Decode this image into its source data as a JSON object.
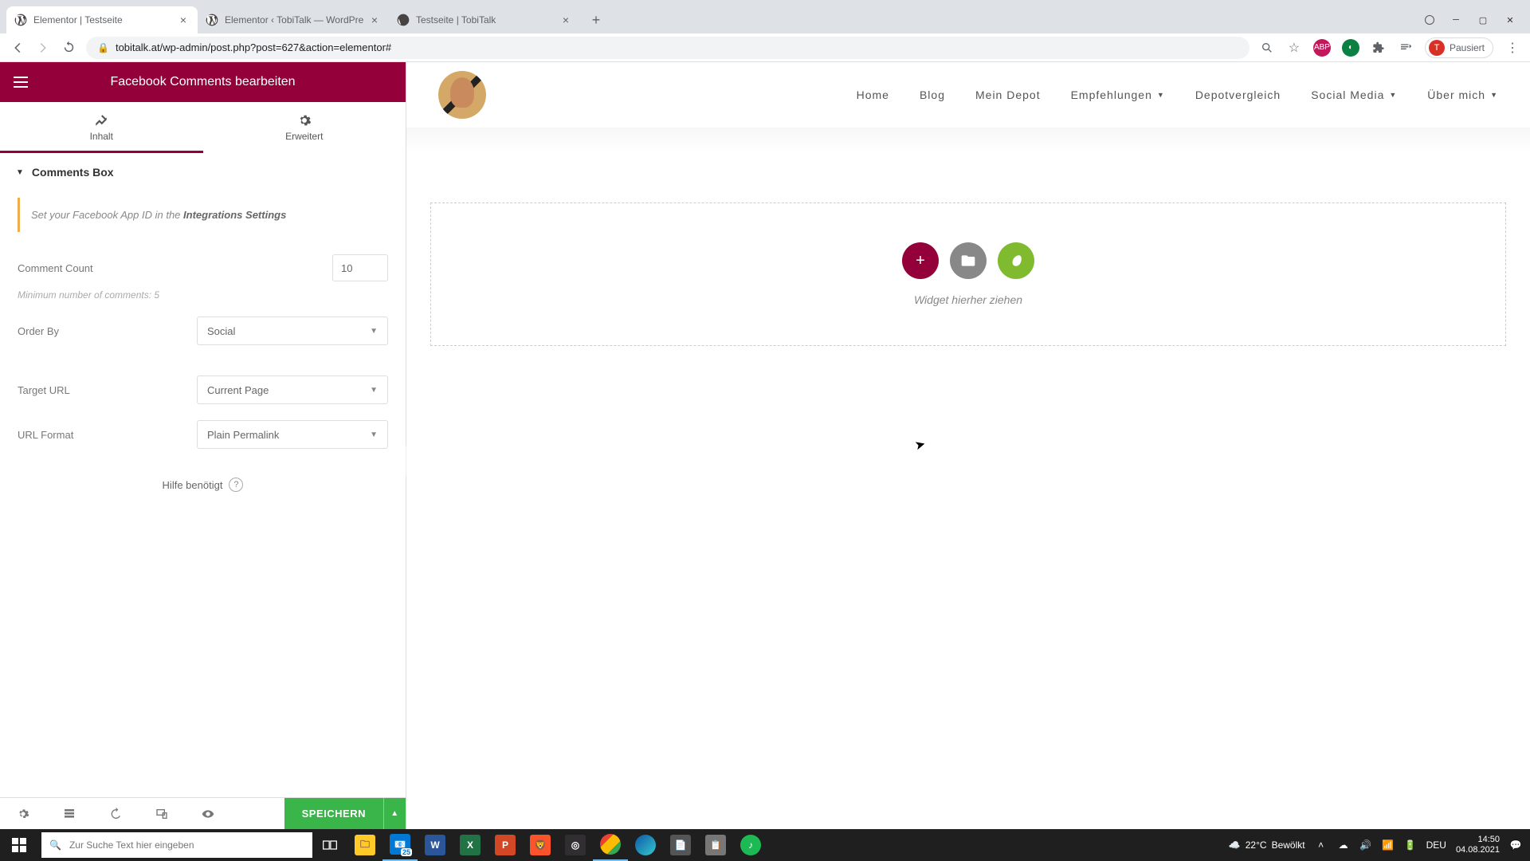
{
  "browser": {
    "tabs": [
      {
        "title": "Elementor | Testseite",
        "active": true
      },
      {
        "title": "Elementor ‹ TobiTalk — WordPre",
        "active": false
      },
      {
        "title": "Testseite | TobiTalk",
        "active": false
      }
    ],
    "url": "tobitalk.at/wp-admin/post.php?post=627&action=elementor#",
    "pause_label": "Pausiert",
    "avatar_letter": "T"
  },
  "sidebar": {
    "title": "Facebook Comments bearbeiten",
    "tabs": {
      "content": "Inhalt",
      "advanced": "Erweitert"
    },
    "section": "Comments Box",
    "notice_pre": "Set your Facebook App ID in the ",
    "notice_link": "Integrations Settings",
    "fields": {
      "comment_count_label": "Comment Count",
      "comment_count_value": "10",
      "comment_count_hint": "Minimum number of comments: 5",
      "order_by_label": "Order By",
      "order_by_value": "Social",
      "target_url_label": "Target URL",
      "target_url_value": "Current Page",
      "url_format_label": "URL Format",
      "url_format_value": "Plain Permalink"
    },
    "help": "Hilfe benötigt",
    "save": "SPEICHERN"
  },
  "page": {
    "nav": {
      "home": "Home",
      "blog": "Blog",
      "depot": "Mein Depot",
      "empf": "Empfehlungen",
      "vergleich": "Depotvergleich",
      "social": "Social Media",
      "about": "Über mich"
    },
    "drop_text": "Widget hierher ziehen"
  },
  "taskbar": {
    "search_placeholder": "Zur Suche Text hier eingeben",
    "weather_temp": "22°C",
    "weather_text": "Bewölkt",
    "lang": "DEU",
    "time": "14:50",
    "date": "04.08.2021",
    "calendar_badge": "25"
  }
}
